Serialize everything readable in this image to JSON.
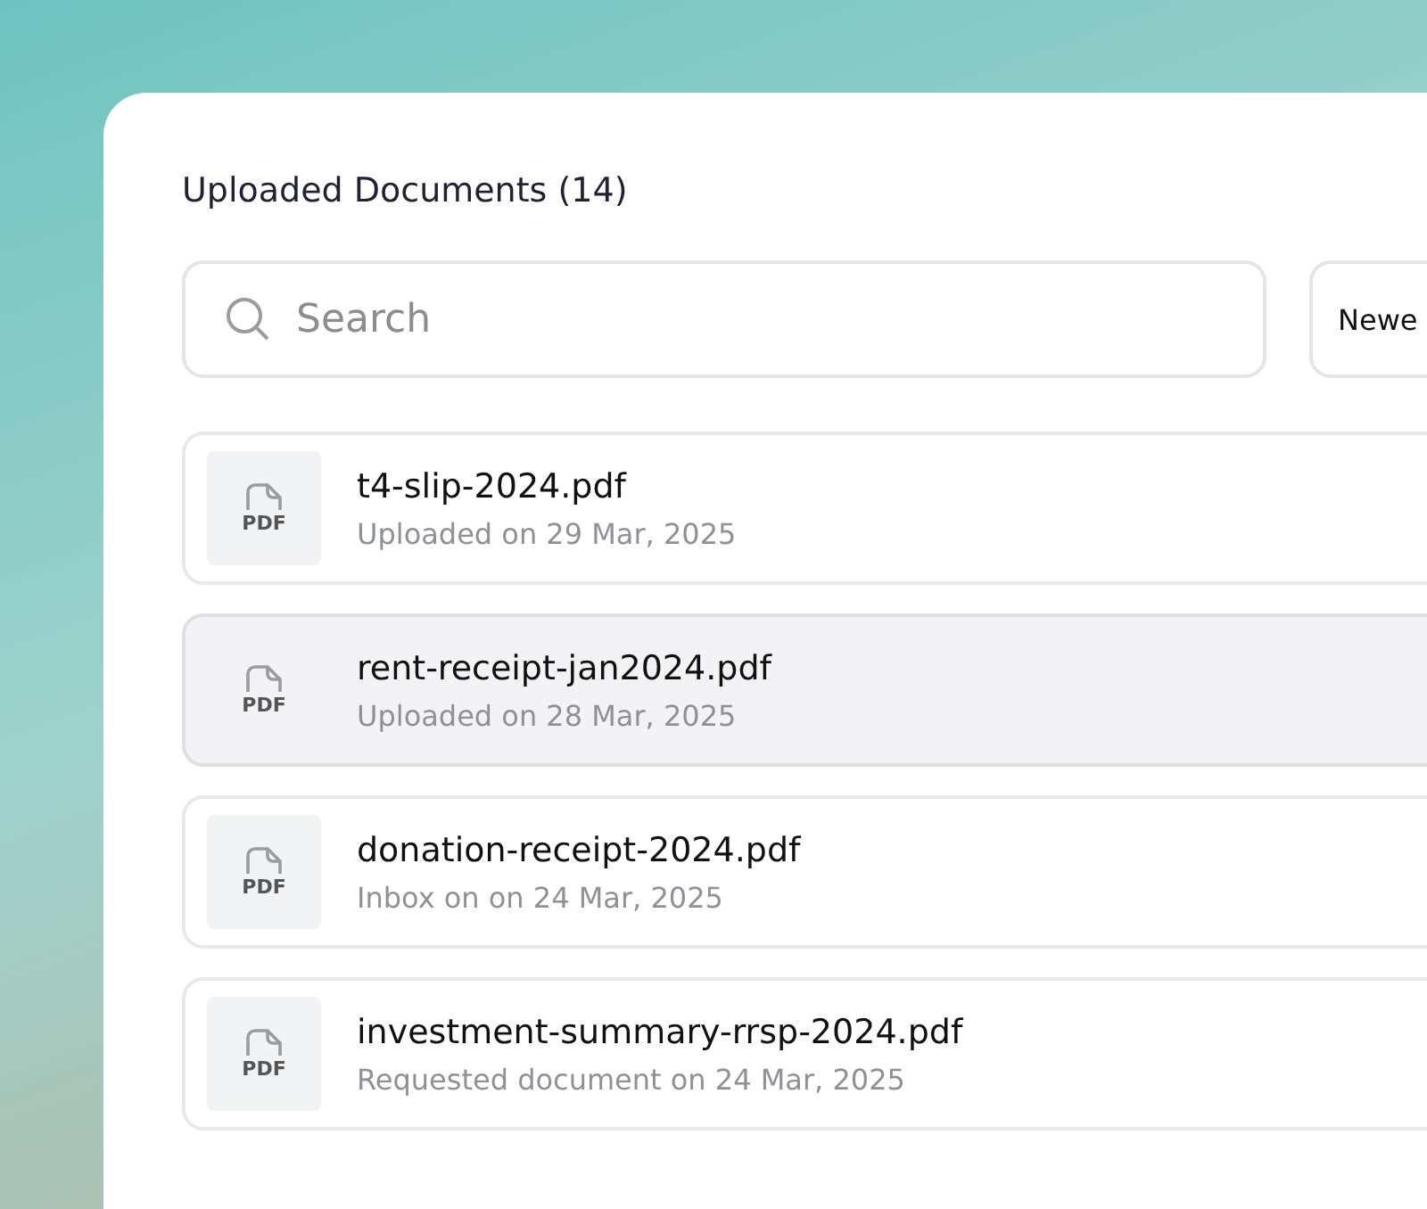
{
  "title": "Uploaded Documents (14)",
  "search": {
    "placeholder": "Search"
  },
  "sort_button": {
    "label": "Newe"
  },
  "documents": [
    {
      "name": "t4-slip-2024.pdf",
      "icon_label": "PDF",
      "detail": "Uploaded on 29 Mar, 2025",
      "selected": false
    },
    {
      "name": "rent-receipt-jan2024.pdf",
      "icon_label": "PDF",
      "detail": "Uploaded on 28 Mar, 2025",
      "selected": true
    },
    {
      "name": "donation-receipt-2024.pdf",
      "icon_label": "PDF",
      "detail": "Inbox on on 24 Mar, 2025",
      "selected": false
    },
    {
      "name": "investment-summary-rrsp-2024.pdf",
      "icon_label": "PDF",
      "detail": "Requested document on 24 Mar, 2025",
      "selected": false
    }
  ]
}
